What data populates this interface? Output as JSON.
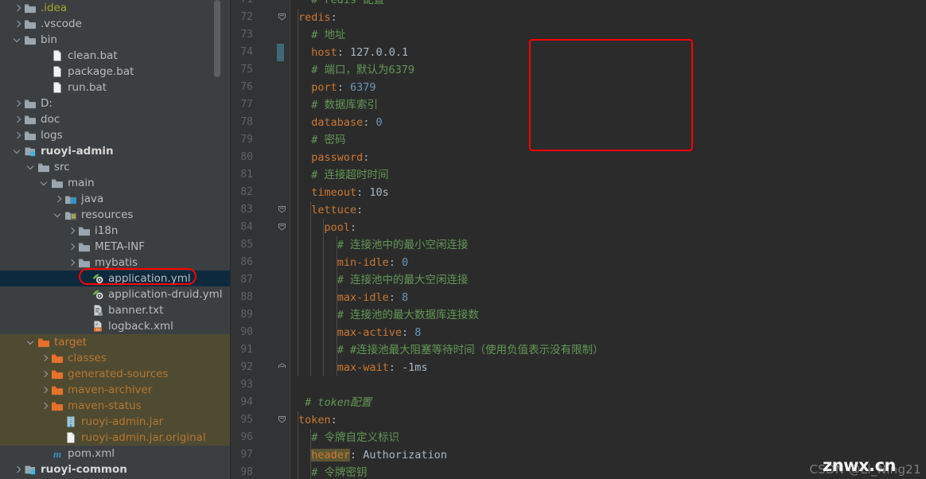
{
  "colors": {
    "annotation": "#fe0000",
    "editor_bg": "#2b2b2b",
    "sidebar_bg": "#3c3f41",
    "gutter_bg": "#313335",
    "selection": "#0d293e",
    "excluded": "#4f4b32",
    "key_orange": "#cc7832",
    "comment_green": "#629755",
    "number_blue": "#6897bb",
    "text_gray": "#a9b7c6",
    "search_highlight": "#5c5632",
    "vcs_modified": "#3d6a76"
  },
  "sidebar": {
    "name": "project-tree",
    "scrollbar": {
      "name": "sidebar-scrollbar"
    },
    "items": [
      {
        "label": ".idea",
        "indent": 0,
        "arrow": "collapsed",
        "icon": "folder-icon",
        "style": "yellowish"
      },
      {
        "label": ".vscode",
        "indent": 0,
        "arrow": "collapsed",
        "icon": "folder-icon",
        "style": ""
      },
      {
        "label": "bin",
        "indent": 0,
        "arrow": "expanded",
        "icon": "folder-icon",
        "style": ""
      },
      {
        "label": "clean.bat",
        "indent": 2,
        "arrow": "none",
        "icon": "file-icon",
        "style": ""
      },
      {
        "label": "package.bat",
        "indent": 2,
        "arrow": "none",
        "icon": "file-icon",
        "style": ""
      },
      {
        "label": "run.bat",
        "indent": 2,
        "arrow": "none",
        "icon": "file-icon",
        "style": ""
      },
      {
        "label": "D:",
        "indent": 0,
        "arrow": "collapsed",
        "icon": "folder-icon",
        "style": ""
      },
      {
        "label": "doc",
        "indent": 0,
        "arrow": "collapsed",
        "icon": "folder-icon",
        "style": ""
      },
      {
        "label": "logs",
        "indent": 0,
        "arrow": "collapsed",
        "icon": "folder-icon",
        "style": ""
      },
      {
        "label": "ruoyi-admin",
        "indent": 0,
        "arrow": "expanded",
        "icon": "module-icon",
        "style": "bold"
      },
      {
        "label": "src",
        "indent": 1,
        "arrow": "expanded",
        "icon": "folder-icon",
        "style": ""
      },
      {
        "label": "main",
        "indent": 2,
        "arrow": "expanded",
        "icon": "folder-icon",
        "style": ""
      },
      {
        "label": "java",
        "indent": 3,
        "arrow": "collapsed",
        "icon": "source-folder-icon",
        "style": ""
      },
      {
        "label": "resources",
        "indent": 3,
        "arrow": "expanded",
        "icon": "resources-folder-icon",
        "style": ""
      },
      {
        "label": "i18n",
        "indent": 4,
        "arrow": "collapsed",
        "icon": "folder-icon",
        "style": ""
      },
      {
        "label": "META-INF",
        "indent": 4,
        "arrow": "collapsed",
        "icon": "folder-icon",
        "style": ""
      },
      {
        "label": "mybatis",
        "indent": 4,
        "arrow": "collapsed",
        "icon": "folder-icon",
        "style": ""
      },
      {
        "label": "application.yml",
        "indent": 5,
        "arrow": "none",
        "icon": "yaml-icon",
        "style": "",
        "selected": true,
        "annotated": true
      },
      {
        "label": "application-druid.yml",
        "indent": 5,
        "arrow": "none",
        "icon": "yaml-icon",
        "style": ""
      },
      {
        "label": "banner.txt",
        "indent": 5,
        "arrow": "none",
        "icon": "text-file-icon",
        "style": ""
      },
      {
        "label": "logback.xml",
        "indent": 5,
        "arrow": "none",
        "icon": "xml-file-icon",
        "style": ""
      },
      {
        "label": "target",
        "indent": 1,
        "arrow": "expanded",
        "icon": "folder-orange-icon",
        "style": "orange",
        "excluded": true
      },
      {
        "label": "classes",
        "indent": 2,
        "arrow": "collapsed",
        "icon": "folder-orange-icon",
        "style": "orange-dim",
        "excluded": true
      },
      {
        "label": "generated-sources",
        "indent": 2,
        "arrow": "collapsed",
        "icon": "folder-orange-icon",
        "style": "orange-dim",
        "excluded": true
      },
      {
        "label": "maven-archiver",
        "indent": 2,
        "arrow": "collapsed",
        "icon": "folder-orange-icon",
        "style": "orange-dim",
        "excluded": true
      },
      {
        "label": "maven-status",
        "indent": 2,
        "arrow": "collapsed",
        "icon": "folder-orange-icon",
        "style": "orange-dim",
        "excluded": true
      },
      {
        "label": "ruoyi-admin.jar",
        "indent": 3,
        "arrow": "none",
        "icon": "jar-icon",
        "style": "orange-dim",
        "excluded": true
      },
      {
        "label": "ruoyi-admin.jar.original",
        "indent": 3,
        "arrow": "none",
        "icon": "file-icon",
        "style": "orange-dim",
        "excluded": true
      },
      {
        "label": "pom.xml",
        "indent": 2,
        "arrow": "none",
        "icon": "maven-icon",
        "style": ""
      },
      {
        "label": "ruoyi-common",
        "indent": 0,
        "arrow": "collapsed",
        "icon": "module-icon",
        "style": "bold"
      }
    ]
  },
  "editor": {
    "name": "code-editor",
    "file": "application.yml",
    "language": "yaml",
    "first_visible_line": 71,
    "annotation": {
      "name": "redis-block-annotation",
      "covers_lines": [
        74,
        79
      ]
    },
    "vcs_change_marker_line": 74,
    "search_highlight_word": "header",
    "lines": [
      {
        "n": 71,
        "indent": 2,
        "tokens": [
          {
            "t": "# redis 配置",
            "c": "cm"
          }
        ]
      },
      {
        "n": 72,
        "indent": 0,
        "fold": "collapse",
        "tokens": [
          {
            "t": "redis",
            "c": "k"
          },
          {
            "t": ":",
            "c": "punct"
          }
        ]
      },
      {
        "n": 73,
        "indent": 2,
        "tokens": [
          {
            "t": "# 地址",
            "c": "cm"
          }
        ]
      },
      {
        "n": 74,
        "indent": 2,
        "tokens": [
          {
            "t": "host",
            "c": "k"
          },
          {
            "t": ": ",
            "c": "punct"
          },
          {
            "t": "127.0.0.1",
            "c": "txt"
          }
        ]
      },
      {
        "n": 75,
        "indent": 2,
        "tokens": [
          {
            "t": "# 端口，默认为6379",
            "c": "cm"
          }
        ]
      },
      {
        "n": 76,
        "indent": 2,
        "tokens": [
          {
            "t": "port",
            "c": "k"
          },
          {
            "t": ": ",
            "c": "punct"
          },
          {
            "t": "6379",
            "c": "num"
          }
        ]
      },
      {
        "n": 77,
        "indent": 2,
        "tokens": [
          {
            "t": "# 数据库索引",
            "c": "cm"
          }
        ]
      },
      {
        "n": 78,
        "indent": 2,
        "tokens": [
          {
            "t": "database",
            "c": "k"
          },
          {
            "t": ": ",
            "c": "punct"
          },
          {
            "t": "0",
            "c": "num"
          }
        ]
      },
      {
        "n": 79,
        "indent": 2,
        "tokens": [
          {
            "t": "# 密码",
            "c": "cm"
          }
        ]
      },
      {
        "n": 80,
        "indent": 2,
        "tokens": [
          {
            "t": "password",
            "c": "k"
          },
          {
            "t": ":",
            "c": "punct"
          }
        ]
      },
      {
        "n": 81,
        "indent": 2,
        "tokens": [
          {
            "t": "# 连接超时时间",
            "c": "cm"
          }
        ]
      },
      {
        "n": 82,
        "indent": 2,
        "tokens": [
          {
            "t": "timeout",
            "c": "k"
          },
          {
            "t": ": ",
            "c": "punct"
          },
          {
            "t": "10s",
            "c": "txt"
          }
        ]
      },
      {
        "n": 83,
        "indent": 2,
        "fold": "collapse",
        "tokens": [
          {
            "t": "lettuce",
            "c": "k"
          },
          {
            "t": ":",
            "c": "punct"
          }
        ]
      },
      {
        "n": 84,
        "indent": 4,
        "fold": "collapse",
        "tokens": [
          {
            "t": "pool",
            "c": "k"
          },
          {
            "t": ":",
            "c": "punct"
          }
        ]
      },
      {
        "n": 85,
        "indent": 6,
        "tokens": [
          {
            "t": "# 连接池中的最小空闲连接",
            "c": "cm"
          }
        ]
      },
      {
        "n": 86,
        "indent": 6,
        "tokens": [
          {
            "t": "min-idle",
            "c": "k"
          },
          {
            "t": ": ",
            "c": "punct"
          },
          {
            "t": "0",
            "c": "num"
          }
        ]
      },
      {
        "n": 87,
        "indent": 6,
        "tokens": [
          {
            "t": "# 连接池中的最大空闲连接",
            "c": "cm"
          }
        ]
      },
      {
        "n": 88,
        "indent": 6,
        "tokens": [
          {
            "t": "max-idle",
            "c": "k"
          },
          {
            "t": ": ",
            "c": "punct"
          },
          {
            "t": "8",
            "c": "num"
          }
        ]
      },
      {
        "n": 89,
        "indent": 6,
        "tokens": [
          {
            "t": "# 连接池的最大数据库连接数",
            "c": "cm"
          }
        ]
      },
      {
        "n": 90,
        "indent": 6,
        "tokens": [
          {
            "t": "max-active",
            "c": "k"
          },
          {
            "t": ": ",
            "c": "punct"
          },
          {
            "t": "8",
            "c": "num"
          }
        ]
      },
      {
        "n": 91,
        "indent": 6,
        "tokens": [
          {
            "t": "# #连接池最大阻塞等待时间（使用负值表示没有限制）",
            "c": "cm"
          }
        ]
      },
      {
        "n": 92,
        "indent": 6,
        "fold": "end",
        "tokens": [
          {
            "t": "max-wait",
            "c": "k"
          },
          {
            "t": ": ",
            "c": "punct"
          },
          {
            "t": "-1ms",
            "c": "txt"
          }
        ]
      },
      {
        "n": 93,
        "indent": 0,
        "tokens": []
      },
      {
        "n": 94,
        "indent": 1,
        "tokens": [
          {
            "t": "# token配置",
            "c": "cm it"
          }
        ]
      },
      {
        "n": 95,
        "indent": 0,
        "fold": "collapse",
        "tokens": [
          {
            "t": "token",
            "c": "k"
          },
          {
            "t": ":",
            "c": "punct"
          }
        ]
      },
      {
        "n": 96,
        "indent": 2,
        "tokens": [
          {
            "t": "# 令牌自定义标识",
            "c": "cm"
          }
        ]
      },
      {
        "n": 97,
        "indent": 2,
        "tokens": [
          {
            "t": "header",
            "c": "hl"
          },
          {
            "t": ": ",
            "c": "punct"
          },
          {
            "t": "Authorization",
            "c": "txt"
          }
        ]
      },
      {
        "n": 98,
        "indent": 2,
        "tokens": [
          {
            "t": "# 令牌密钥",
            "c": "cm"
          }
        ]
      }
    ]
  },
  "watermark": {
    "name": "watermark",
    "back_text": "CSDN @Li_Ning21",
    "front_text": "znwx.cn"
  }
}
